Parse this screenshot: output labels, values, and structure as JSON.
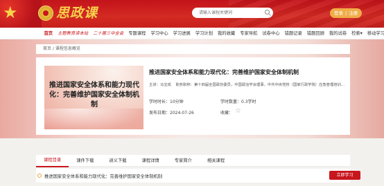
{
  "header": {
    "logo_text": "思政课",
    "search_placeholder": "请输入课程关键词",
    "login": "登录",
    "separator": "|",
    "register": "注册"
  },
  "nav": {
    "items": [
      "首页",
      "主题教育读本站",
      "二十届三中全会",
      "专题课程",
      "学习中心",
      "学习进展",
      "学习计划",
      "我的收藏",
      "专家导航",
      "试卷中心",
      "错题记录",
      "错题回顾",
      "我的试卷",
      "检索▾",
      "移动学习"
    ]
  },
  "breadcrumb": {
    "home": "首页",
    "sep": "/",
    "current": "课程信息概览"
  },
  "course": {
    "thumb_text": "推进国家安全体系和能力现代化：完善维护国家安全体制机制",
    "title": "推进国家安全体系和能力现代化：完善维护国家安全体制机制",
    "speaker": "主讲：马宝成",
    "position": "职务职称：第十四届全国政协委员，中国政治学会理事，中共中央党校（国家行政学院）应急管理培训…",
    "duration": "学时时长：10分钟",
    "credit": "学时数量：0.3学时",
    "date": "发布日期：2024-07-26",
    "favorite": "收藏："
  },
  "tabs": {
    "items": [
      "课程目录",
      "课件下载",
      "讲义下载",
      "课程详情",
      "专家简介",
      "相关课程"
    ]
  },
  "lesson": {
    "title": "推进国家安全体系和能力现代化：完善维护国家安全体制机制",
    "button": "立即学习"
  },
  "colors": {
    "primary_red": "#c8161d",
    "gold": "#f7d24c",
    "button_orange": "#f0ad48"
  }
}
